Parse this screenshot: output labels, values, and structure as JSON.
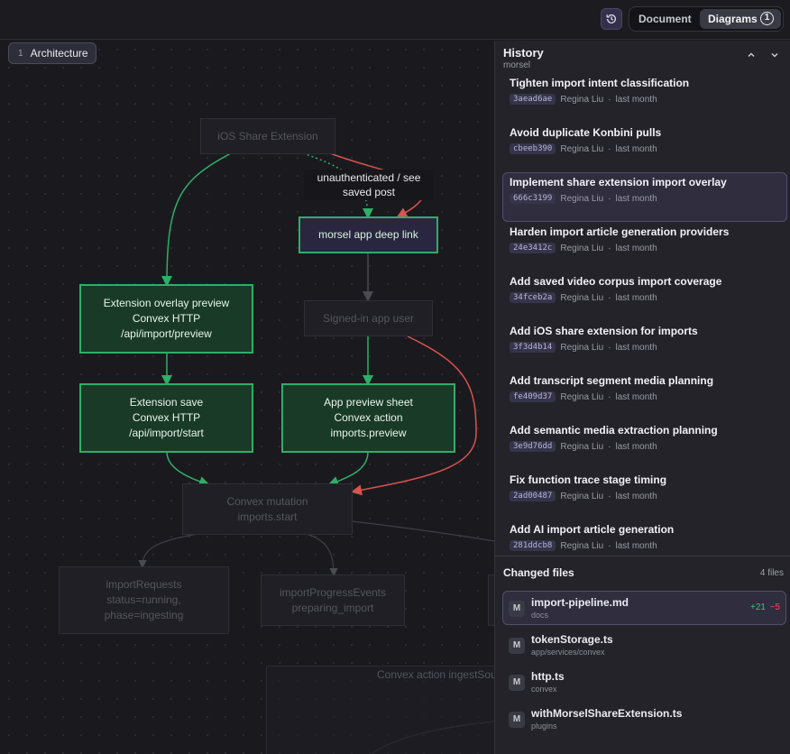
{
  "topbar": {
    "history_icon": "history-icon",
    "document_label": "Document",
    "diagrams_label": "Diagrams",
    "diagrams_badge": "1"
  },
  "canvas": {
    "tab_number": "1",
    "tab_label": "Architecture",
    "nodes": {
      "ios_share": "iOS Share Extension",
      "unauth_label_1": "unauthenticated / see",
      "unauth_label_2": "saved post",
      "deep_link": "morsel app deep link",
      "overlay_1": "Extension overlay preview",
      "overlay_2": "Convex HTTP",
      "overlay_3": "/api/import/preview",
      "signed_in": "Signed-in app user",
      "save_1": "Extension save",
      "save_2": "Convex HTTP",
      "save_3": "/api/import/start",
      "sheet_1": "App preview sheet",
      "sheet_2": "Convex action",
      "sheet_3": "imports.preview",
      "mutation_1": "Convex mutation",
      "mutation_2": "imports.start",
      "requests_1": "importRequests",
      "requests_2": "status=running,",
      "requests_3": "phase=ingesting",
      "progress_1": "importProgressEvents",
      "progress_2": "preparing_import",
      "action_group": "Convex action ingestSou"
    },
    "colors": {
      "green_edge": "#2fae67",
      "red_edge": "#d9534f"
    }
  },
  "history": {
    "title": "History",
    "subtitle": "morsel",
    "commits": [
      {
        "title": "Tighten import intent classification",
        "hash": "3aead6ae",
        "author": "Regina Liu",
        "when": "last month"
      },
      {
        "title": "Avoid duplicate Konbini pulls",
        "hash": "cbeeb390",
        "author": "Regina Liu",
        "when": "last month"
      },
      {
        "title": "Implement share extension import overlay",
        "hash": "666c3199",
        "author": "Regina Liu",
        "when": "last month"
      },
      {
        "title": "Harden import article generation providers",
        "hash": "24e3412c",
        "author": "Regina Liu",
        "when": "last month"
      },
      {
        "title": "Add saved video corpus import coverage",
        "hash": "34fceb2a",
        "author": "Regina Liu",
        "when": "last month"
      },
      {
        "title": "Add iOS share extension for imports",
        "hash": "3f3d4b14",
        "author": "Regina Liu",
        "when": "last month"
      },
      {
        "title": "Add transcript segment media planning",
        "hash": "fe409d37",
        "author": "Regina Liu",
        "when": "last month"
      },
      {
        "title": "Add semantic media extraction planning",
        "hash": "3e9d76dd",
        "author": "Regina Liu",
        "when": "last month"
      },
      {
        "title": "Fix function trace stage timing",
        "hash": "2ad00487",
        "author": "Regina Liu",
        "when": "last month"
      },
      {
        "title": "Add AI import article generation",
        "hash": "281ddcb8",
        "author": "Regina Liu",
        "when": "last month"
      }
    ],
    "separator": "·"
  },
  "changed_files": {
    "title": "Changed files",
    "count": "4 files",
    "files": [
      {
        "status": "M",
        "name": "import-pipeline.md",
        "dir": "docs",
        "added": "+21",
        "removed": "−5"
      },
      {
        "status": "M",
        "name": "tokenStorage.ts",
        "dir": "app/services/convex"
      },
      {
        "status": "M",
        "name": "http.ts",
        "dir": "convex"
      },
      {
        "status": "M",
        "name": "withMorselShareExtension.ts",
        "dir": "plugins"
      }
    ]
  }
}
